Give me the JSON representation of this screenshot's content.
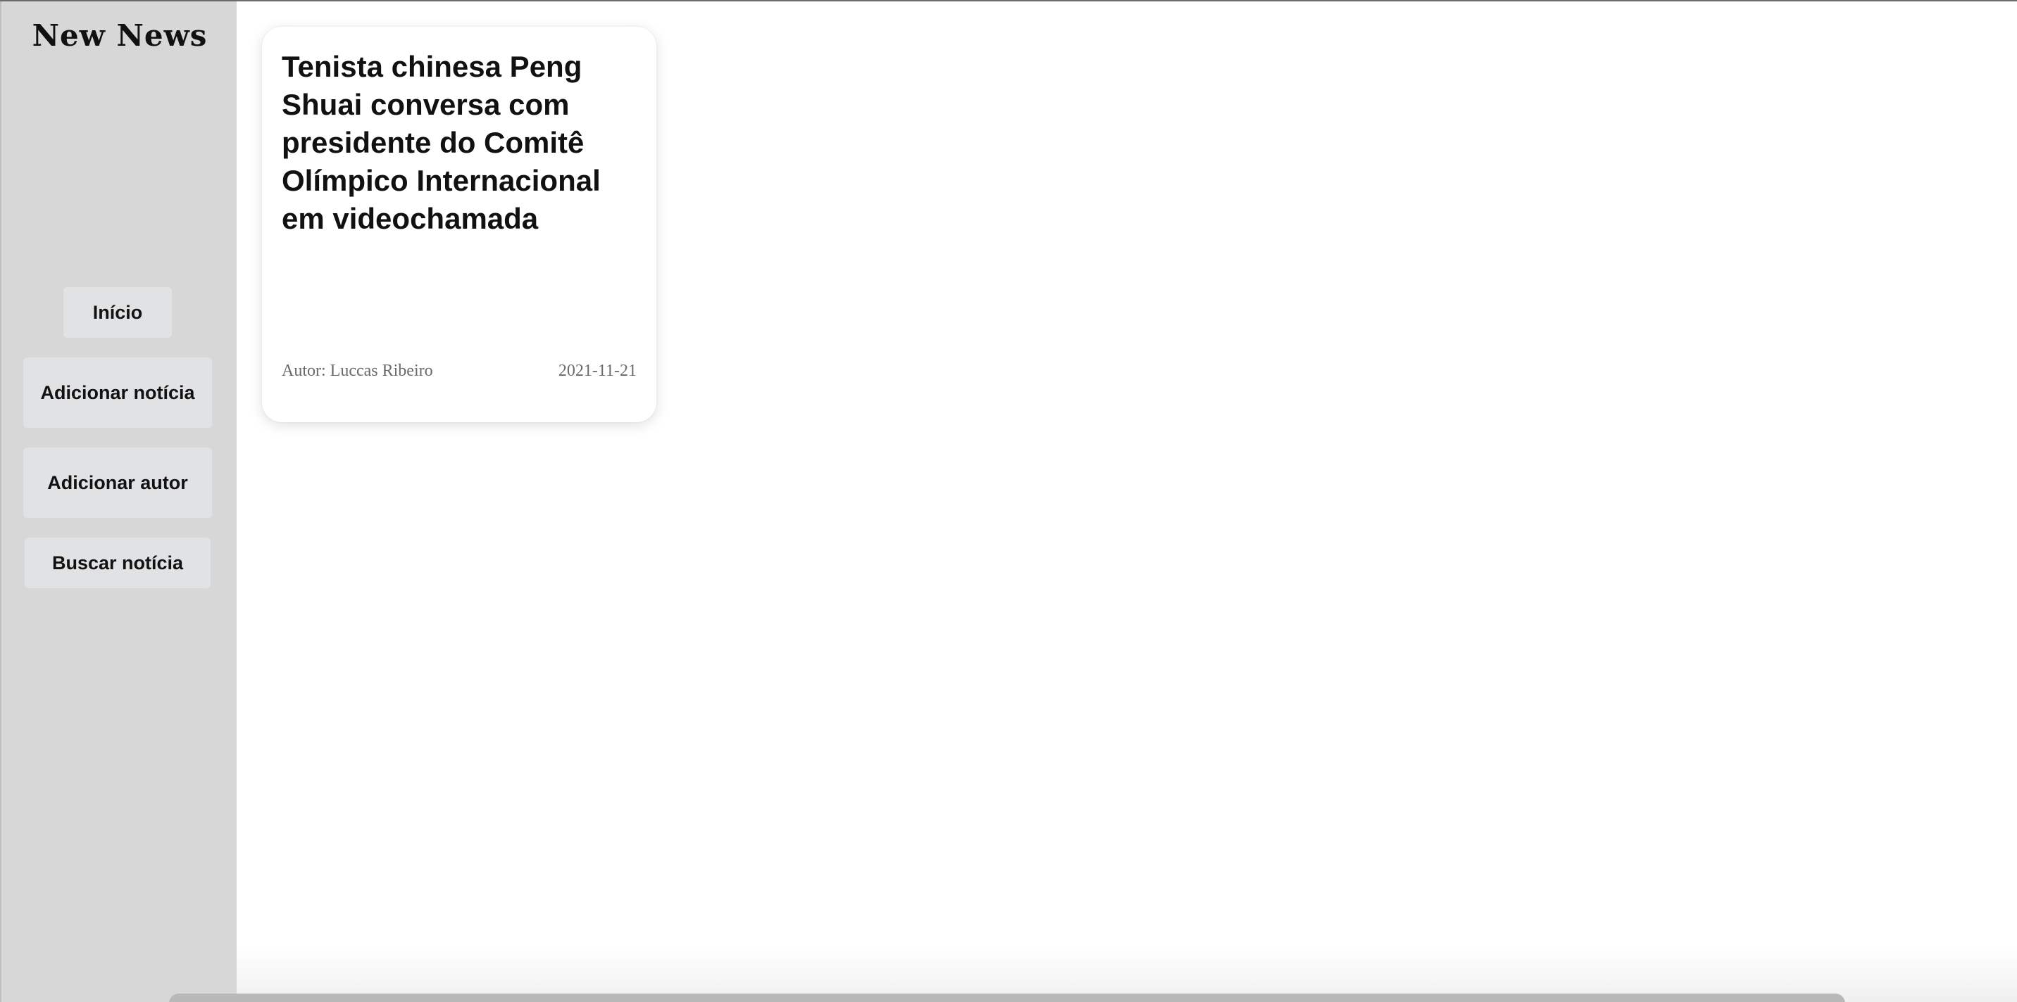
{
  "sidebar": {
    "logo": "New News",
    "nav": [
      {
        "label": "Início"
      },
      {
        "label": "Adicionar notícia"
      },
      {
        "label": "Adicionar autor"
      },
      {
        "label": "Buscar notícia"
      }
    ]
  },
  "news": [
    {
      "title": "Tenista chinesa Peng Shuai conversa com presidente do Comitê Olímpico Internacional em videochamada",
      "author": "Autor: Luccas Ribeiro",
      "date": "2021-11-21"
    }
  ]
}
